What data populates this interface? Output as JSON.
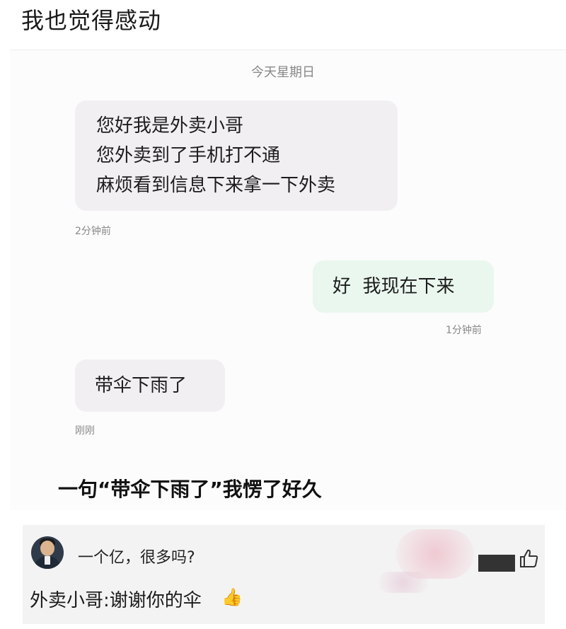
{
  "post": {
    "title": "我也觉得感动"
  },
  "chat": {
    "date_separator": "今天星期日",
    "messages": [
      {
        "side": "incoming",
        "lines": [
          "您好我是外卖小哥",
          "您外卖到了手机打不通",
          "麻烦看到信息下来拿一下外卖"
        ],
        "time": "2分钟前"
      },
      {
        "side": "outgoing",
        "lines": [
          "好  我现在下来"
        ],
        "time": "1分钟前"
      },
      {
        "side": "incoming",
        "lines": [
          "带伞下雨了"
        ],
        "time": "刚刚"
      }
    ],
    "caption": "一句“带伞下雨了”我愣了好久"
  },
  "comment": {
    "text": "一个亿，很多吗?",
    "reply": "外卖小哥:谢谢你的伞",
    "like_icon": "thumbs-up-outline-icon",
    "emoji": "👍"
  },
  "colors": {
    "incoming_bubble": "#f2eff3",
    "outgoing_bubble": "#eaf7ee",
    "comment_bg": "#f3f3f3"
  }
}
